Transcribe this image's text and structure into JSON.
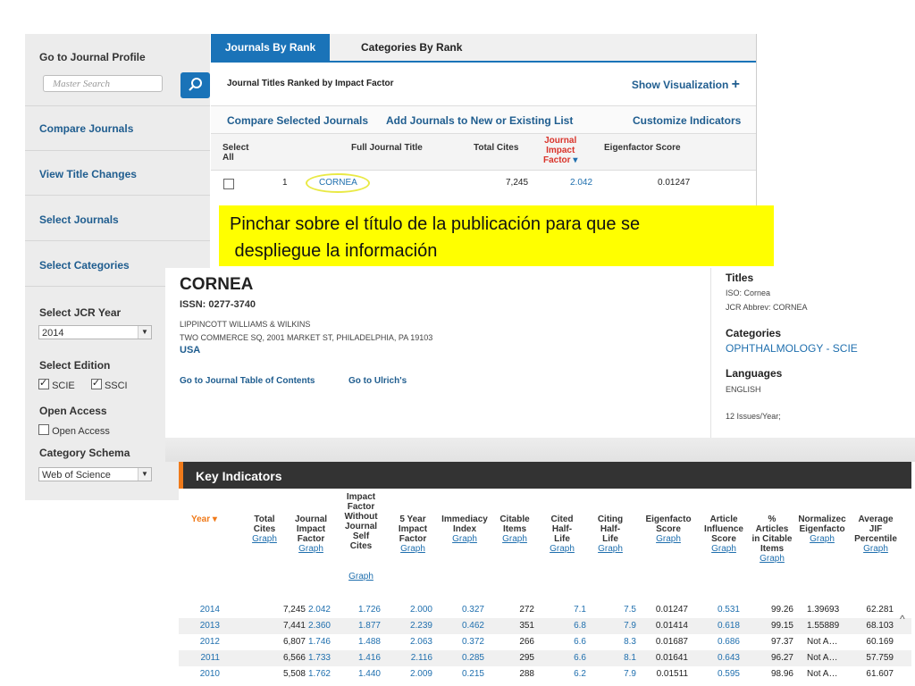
{
  "sidebar": {
    "go_profile": "Go to Journal Profile",
    "search_placeholder": "Master Search",
    "compare": "Compare Journals",
    "title_changes": "View Title Changes",
    "select_journals": "Select Journals",
    "select_categories": "Select Categories",
    "jcr_year_label": "Select JCR Year",
    "jcr_year_value": "2014",
    "edition_label": "Select Edition",
    "edition_scie": "SCIE",
    "edition_ssci": "SSCI",
    "open_access_label": "Open Access",
    "open_access_option": "Open Access",
    "schema_label": "Category Schema",
    "schema_value": "Web of Science"
  },
  "tabs": {
    "journals_by_rank": "Journals By Rank",
    "categories_by_rank": "Categories By Rank"
  },
  "ranked": {
    "subtitle": "Journal Titles Ranked by Impact Factor",
    "show_vis": "Show Visualization",
    "compare_selected": "Compare Selected Journals",
    "add_to_list": "Add Journals to New or Existing List",
    "customize": "Customize Indicators",
    "headers": {
      "select": "Select",
      "all": "All",
      "title": "Full Journal Title",
      "cites": "Total Cites",
      "jif1": "Journal",
      "jif2": "Impact",
      "jif3": "Factor",
      "eigen": "Eigenfactor Score"
    },
    "row": {
      "rank": "1",
      "title": "CORNEA",
      "cites": "7,245",
      "jif": "2.042",
      "eigen": "0.01247"
    }
  },
  "banner": {
    "line1": "Pinchar sobre el título de la publicación para que se",
    "line2": " despliegue la información"
  },
  "profile": {
    "title": "CORNEA",
    "issn": "ISSN: 0277-3740",
    "publisher": "LIPPINCOTT WILLIAMS & WILKINS",
    "address": "TWO COMMERCE SQ, 2001 MARKET ST, PHILADELPHIA, PA 19103",
    "country": "USA",
    "toc_link": "Go to Journal Table of Contents",
    "ulrich_link": "Go to Ulrich's",
    "titles_h": "Titles",
    "iso": "ISO: Cornea",
    "jcr_abbrev": "JCR Abbrev: CORNEA",
    "categories_h": "Categories",
    "category": "OPHTHALMOLOGY - SCIE",
    "languages_h": "Languages",
    "language": "ENGLISH",
    "issues": "12 Issues/Year;"
  },
  "key_indicators": {
    "title": "Key Indicators",
    "graph": "Graph",
    "columns": [
      {
        "lines": [
          "Year ▾"
        ]
      },
      {
        "lines": [
          "Total",
          "Cites"
        ]
      },
      {
        "lines": [
          "Journal",
          "Impact",
          "Factor"
        ]
      },
      {
        "lines": [
          "Impact",
          "Factor",
          "Without",
          "Journal",
          "Self",
          "Cites"
        ]
      },
      {
        "lines": [
          "5 Year",
          "Impact",
          "Factor"
        ]
      },
      {
        "lines": [
          "Immediacy",
          "Index"
        ]
      },
      {
        "lines": [
          "Citable",
          "Items"
        ]
      },
      {
        "lines": [
          "Cited",
          "Half-",
          "Life"
        ]
      },
      {
        "lines": [
          "Citing",
          "Half-",
          "Life"
        ]
      },
      {
        "lines": [
          "Eigenfacto",
          "Score"
        ]
      },
      {
        "lines": [
          "Article",
          "Influence",
          "Score"
        ]
      },
      {
        "lines": [
          "%",
          "Articles",
          "in Citable",
          "Items"
        ]
      },
      {
        "lines": [
          "Normalizec",
          "Eigenfacto"
        ]
      },
      {
        "lines": [
          "Average",
          "JIF",
          "Percentile"
        ]
      }
    ],
    "rows": [
      [
        "2014",
        "7,245",
        "2.042",
        "1.726",
        "2.000",
        "0.327",
        "272",
        "7.1",
        "7.5",
        "0.01247",
        "0.531",
        "99.26",
        "1.39693",
        "62.281"
      ],
      [
        "2013",
        "7,441",
        "2.360",
        "1.877",
        "2.239",
        "0.462",
        "351",
        "6.8",
        "7.9",
        "0.01414",
        "0.618",
        "99.15",
        "1.55889",
        "68.103"
      ],
      [
        "2012",
        "6,807",
        "1.746",
        "1.488",
        "2.063",
        "0.372",
        "266",
        "6.6",
        "8.3",
        "0.01687",
        "0.686",
        "97.37",
        "Not A…",
        "60.169"
      ],
      [
        "2011",
        "6,566",
        "1.733",
        "1.416",
        "2.116",
        "0.285",
        "295",
        "6.6",
        "8.1",
        "0.01641",
        "0.643",
        "96.27",
        "Not A…",
        "57.759"
      ],
      [
        "2010",
        "5,508",
        "1.762",
        "1.440",
        "2.009",
        "0.215",
        "288",
        "6.2",
        "7.9",
        "0.01511",
        "0.595",
        "98.96",
        "Not A…",
        "61.607"
      ]
    ]
  }
}
